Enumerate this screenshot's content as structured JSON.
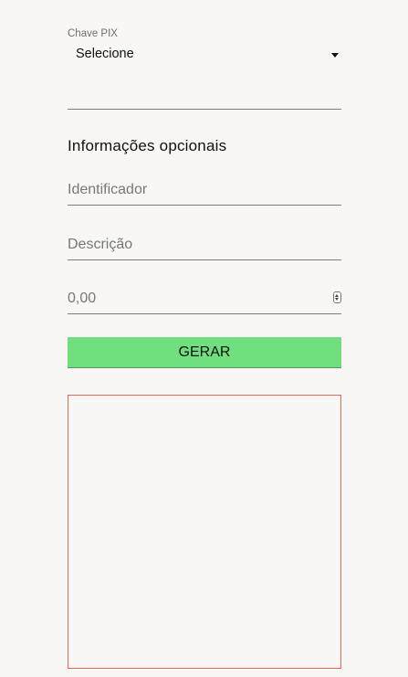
{
  "form": {
    "pix_key_label": "Chave PIX",
    "pix_key_selected": "Selecione",
    "optional_section_title": "Informações opcionais",
    "identifier_placeholder": "Identificador",
    "description_placeholder": "Descrição",
    "amount_placeholder": "0,00",
    "generate_button_label": "GERAR"
  },
  "colors": {
    "background": "#f8f7f5",
    "generate_button": "#6fe07d",
    "qr_box_border": "#e26a5c",
    "underline": "#7a7a7a"
  },
  "icons": {
    "select_caret": "caret-down-icon",
    "amount_spinner": "number-spinner-icon"
  }
}
